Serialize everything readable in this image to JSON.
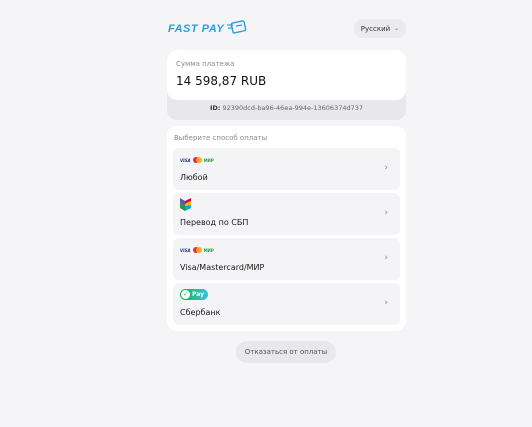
{
  "header": {
    "logo_text": "FAST PAY",
    "language": "Русский"
  },
  "payment": {
    "amount_label": "Сумма платежа",
    "amount_value": "14 598,87 RUB",
    "id_label": "ID:",
    "id_value": "92390dcd-ba96-46ea-994e-13606374d737"
  },
  "methods": {
    "title": "Выберите способ оплаты",
    "items": [
      {
        "label": "Любой",
        "icon": "card-brands-icon"
      },
      {
        "label": "Перевод по СБП",
        "icon": "sbp-icon"
      },
      {
        "label": "Visa/Mastercard/МИР",
        "icon": "card-brands-icon"
      },
      {
        "label": "Сбербанк",
        "icon": "sberpay-icon"
      }
    ],
    "card_brands": {
      "visa": "VISA",
      "mir": "МИР"
    },
    "sberpay_text": "Pay"
  },
  "cancel_label": "Отказаться от оплаты",
  "colors": {
    "brand": "#2a9fd8",
    "background": "#f5f5f7",
    "card": "#ffffff",
    "method_bg": "#f4f4f6",
    "mastercard_red": "#eb2a30",
    "mastercard_yellow": "#f8a51a",
    "mir_green": "#2c9a48",
    "sber_green": "#19b24a"
  }
}
